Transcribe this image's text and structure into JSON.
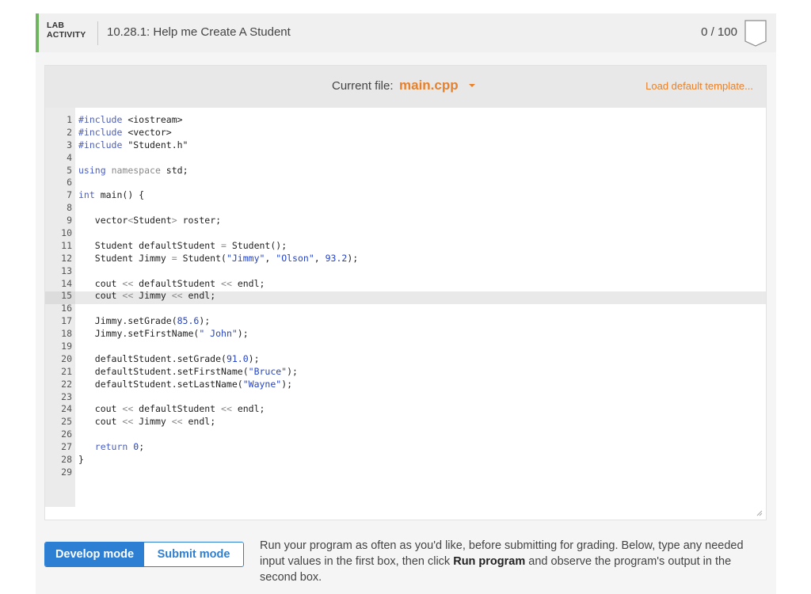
{
  "header": {
    "lab_label_line1": "LAB",
    "lab_label_line2": "ACTIVITY",
    "title": "10.28.1: Help me Create A Student",
    "score": "0 / 100"
  },
  "editor": {
    "current_file_label": "Current file:",
    "file_name": "main.cpp",
    "load_template_label": "Load default template...",
    "highlighted_line": 15,
    "code_lines": [
      {
        "n": "1",
        "parts": [
          {
            "c": "kw",
            "t": "#include"
          },
          {
            "c": "",
            "t": " <iostream>"
          }
        ]
      },
      {
        "n": "2",
        "parts": [
          {
            "c": "kw",
            "t": "#include"
          },
          {
            "c": "",
            "t": " <vector>"
          }
        ]
      },
      {
        "n": "3",
        "parts": [
          {
            "c": "kw",
            "t": "#include"
          },
          {
            "c": "",
            "t": " \"Student.h\""
          }
        ]
      },
      {
        "n": "4",
        "parts": []
      },
      {
        "n": "5",
        "parts": [
          {
            "c": "kw",
            "t": "using"
          },
          {
            "c": "",
            "t": " "
          },
          {
            "c": "ns",
            "t": "namespace"
          },
          {
            "c": "",
            "t": " std;"
          }
        ]
      },
      {
        "n": "6",
        "parts": []
      },
      {
        "n": "7",
        "parts": [
          {
            "c": "kw",
            "t": "int"
          },
          {
            "c": "",
            "t": " main() {"
          }
        ]
      },
      {
        "n": "8",
        "parts": []
      },
      {
        "n": "9",
        "parts": [
          {
            "c": "",
            "t": "   vector"
          },
          {
            "c": "ns",
            "t": "<"
          },
          {
            "c": "",
            "t": "Student"
          },
          {
            "c": "ns",
            "t": ">"
          },
          {
            "c": "",
            "t": " roster;"
          }
        ]
      },
      {
        "n": "10",
        "parts": []
      },
      {
        "n": "11",
        "parts": [
          {
            "c": "",
            "t": "   Student defaultStudent "
          },
          {
            "c": "ns",
            "t": "="
          },
          {
            "c": "",
            "t": " Student();"
          }
        ]
      },
      {
        "n": "12",
        "parts": [
          {
            "c": "",
            "t": "   Student Jimmy "
          },
          {
            "c": "ns",
            "t": "="
          },
          {
            "c": "",
            "t": " Student("
          },
          {
            "c": "str",
            "t": "\"Jimmy\""
          },
          {
            "c": "",
            "t": ", "
          },
          {
            "c": "str",
            "t": "\"Olson\""
          },
          {
            "c": "",
            "t": ", "
          },
          {
            "c": "num",
            "t": "93.2"
          },
          {
            "c": "",
            "t": ");"
          }
        ]
      },
      {
        "n": "13",
        "parts": []
      },
      {
        "n": "14",
        "parts": [
          {
            "c": "",
            "t": "   cout "
          },
          {
            "c": "ns",
            "t": "<<"
          },
          {
            "c": "",
            "t": " defaultStudent "
          },
          {
            "c": "ns",
            "t": "<<"
          },
          {
            "c": "",
            "t": " endl;"
          }
        ]
      },
      {
        "n": "15",
        "parts": [
          {
            "c": "",
            "t": "   cout "
          },
          {
            "c": "ns",
            "t": "<<"
          },
          {
            "c": "",
            "t": " Jimmy "
          },
          {
            "c": "ns",
            "t": "<<"
          },
          {
            "c": "",
            "t": " endl;"
          }
        ]
      },
      {
        "n": "16",
        "parts": []
      },
      {
        "n": "17",
        "parts": [
          {
            "c": "",
            "t": "   Jimmy.setGrade("
          },
          {
            "c": "num",
            "t": "85.6"
          },
          {
            "c": "",
            "t": ");"
          }
        ]
      },
      {
        "n": "18",
        "parts": [
          {
            "c": "",
            "t": "   Jimmy.setFirstName("
          },
          {
            "c": "str",
            "t": "\" John\""
          },
          {
            "c": "",
            "t": ");"
          }
        ]
      },
      {
        "n": "19",
        "parts": []
      },
      {
        "n": "20",
        "parts": [
          {
            "c": "",
            "t": "   defaultStudent.setGrade("
          },
          {
            "c": "num",
            "t": "91.0"
          },
          {
            "c": "",
            "t": ");"
          }
        ]
      },
      {
        "n": "21",
        "parts": [
          {
            "c": "",
            "t": "   defaultStudent.setFirstName("
          },
          {
            "c": "str",
            "t": "\"Bruce\""
          },
          {
            "c": "",
            "t": ");"
          }
        ]
      },
      {
        "n": "22",
        "parts": [
          {
            "c": "",
            "t": "   defaultStudent.setLastName("
          },
          {
            "c": "str",
            "t": "\"Wayne\""
          },
          {
            "c": "",
            "t": ");"
          }
        ]
      },
      {
        "n": "23",
        "parts": []
      },
      {
        "n": "24",
        "parts": [
          {
            "c": "",
            "t": "   cout "
          },
          {
            "c": "ns",
            "t": "<<"
          },
          {
            "c": "",
            "t": " defaultStudent "
          },
          {
            "c": "ns",
            "t": "<<"
          },
          {
            "c": "",
            "t": " endl;"
          }
        ]
      },
      {
        "n": "25",
        "parts": [
          {
            "c": "",
            "t": "   cout "
          },
          {
            "c": "ns",
            "t": "<<"
          },
          {
            "c": "",
            "t": " Jimmy "
          },
          {
            "c": "ns",
            "t": "<<"
          },
          {
            "c": "",
            "t": " endl;"
          }
        ]
      },
      {
        "n": "26",
        "parts": []
      },
      {
        "n": "27",
        "parts": [
          {
            "c": "",
            "t": "   "
          },
          {
            "c": "kw",
            "t": "return"
          },
          {
            "c": "",
            "t": " "
          },
          {
            "c": "num",
            "t": "0"
          },
          {
            "c": "",
            "t": ";"
          }
        ]
      },
      {
        "n": "28",
        "parts": [
          {
            "c": "",
            "t": "}"
          }
        ]
      },
      {
        "n": "29",
        "parts": []
      }
    ]
  },
  "modes": {
    "develop_label": "Develop mode",
    "submit_label": "Submit mode",
    "active": "develop"
  },
  "instructions": {
    "part1": "Run your program as often as you'd like, before submitting for grading. Below, type any needed input values in the first box, then click ",
    "bold1": "Run program",
    "part2": " and observe the program's output in the second box."
  },
  "colors": {
    "accent_orange": "#e8812a",
    "accent_blue": "#2d7fd3",
    "lab_green": "#6fb560",
    "keyword_blue": "#4b5ec4",
    "string_blue": "#2443c9"
  },
  "icons": {
    "score_badge": "score-badge-icon",
    "file_dropdown": "caret-down-icon",
    "resize": "resize-grip-icon"
  }
}
